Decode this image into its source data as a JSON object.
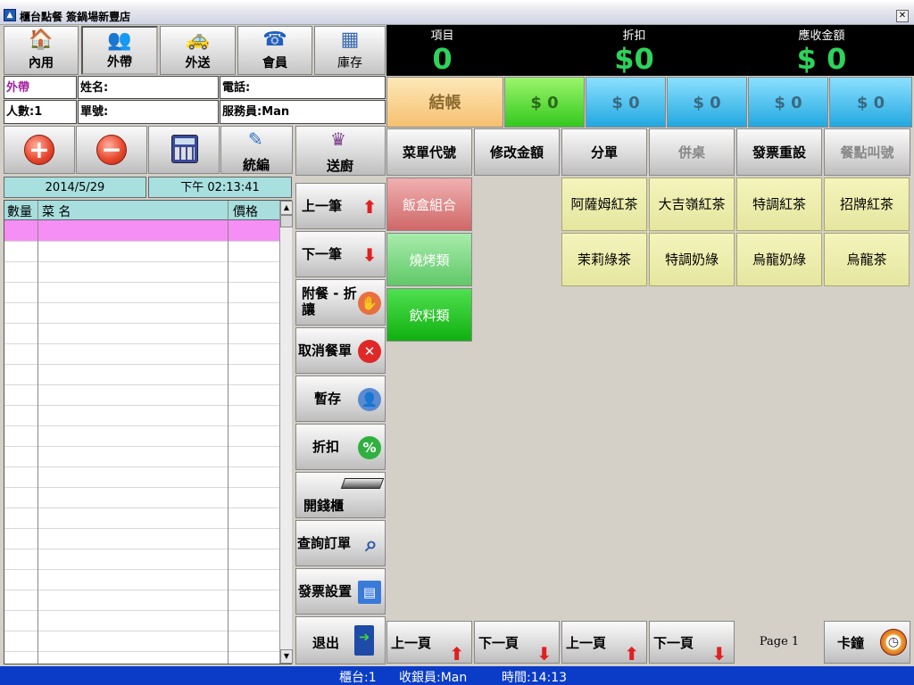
{
  "window": {
    "title": "櫃台點餐 簽鍋場新豐店",
    "close": "✕"
  },
  "toolbar": [
    {
      "label": "內用",
      "icon": "house-icon",
      "glyph": "🏠"
    },
    {
      "label": "外帶",
      "icon": "people-icon",
      "glyph": "👥"
    },
    {
      "label": "外送",
      "icon": "taxi-icon",
      "glyph": "🚕"
    },
    {
      "label": "會員",
      "icon": "phone-icon",
      "glyph": "☎"
    },
    {
      "label": "庫存",
      "icon": "inventory-icon",
      "glyph": "▦"
    }
  ],
  "summary": {
    "items_label": "項目",
    "items_value": "0",
    "discount_label": "折扣",
    "discount_value": "$0",
    "receivable_label": "應收金額",
    "receivable_value": "$ 0"
  },
  "info": {
    "mode": "外帶",
    "name": "姓名:",
    "phone": "電話:",
    "people": "人數:1",
    "order_no": "單號:",
    "server": "服務員:Man"
  },
  "payments": {
    "checkout": "結帳",
    "p1": "$ 0",
    "p2": "$ 0",
    "p3": "$ 0",
    "p4": "$ 0",
    "p5": "$ 0"
  },
  "actions": {
    "plus": "+",
    "minus": "−",
    "tax_id": "統編",
    "send_kitchen": "送廚"
  },
  "datetime": {
    "date": "2014/5/29",
    "time": "下午 02:13:41"
  },
  "order_table": {
    "col_qty": "數量",
    "col_name": "菜  名",
    "col_price": "價格"
  },
  "mid_buttons": {
    "prev": "上一筆",
    "next": "下一筆",
    "addon": "附餐 - 折讓",
    "cancel": "取消餐單",
    "hold": "暫存",
    "discount": "折扣",
    "drawer": "開錢櫃",
    "query": "查詢訂單",
    "invoice": "發票設置",
    "exit": "退出"
  },
  "func_buttons": [
    "菜單代號",
    "修改金額",
    "分單",
    "併桌",
    "發票重設",
    "餐點叫號"
  ],
  "categories": [
    "飯盒組合",
    "燒烤類",
    "飲料類"
  ],
  "items": [
    "阿薩姆紅茶",
    "大吉嶺紅茶",
    "特調紅茶",
    "招牌紅茶",
    "茉莉綠茶",
    "特調奶綠",
    "烏龍奶綠",
    "烏龍茶"
  ],
  "paging": {
    "cat_up": "上一頁",
    "cat_down": "下一頁",
    "item_up": "上一頁",
    "item_down": "下一頁",
    "page": "Page 1",
    "clock": "卡鐘"
  },
  "status": {
    "counter": "櫃台:1",
    "cashier": "收銀員:Man",
    "time": "時間:14:13"
  },
  "colors": {
    "summary_green": "#2ed35a",
    "status_blue": "#0a3cc8",
    "selected_row": "#f58ff5",
    "item_yellow": "#e6e6a0"
  }
}
